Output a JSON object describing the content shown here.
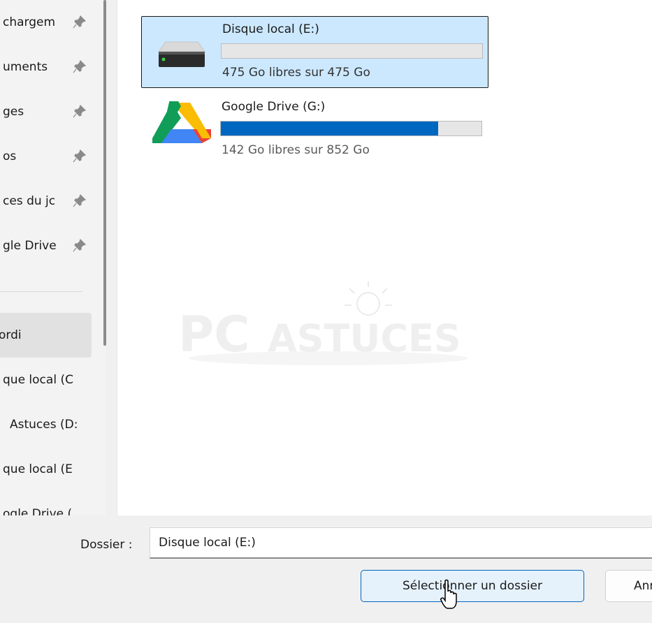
{
  "nav": {
    "items": [
      {
        "label": "chargem",
        "pinned": true
      },
      {
        "label": "uments",
        "pinned": true
      },
      {
        "label": "ges",
        "pinned": true
      },
      {
        "label": "os",
        "pinned": true
      },
      {
        "label": "ces du jc",
        "pinned": true
      },
      {
        "label": "gle Drive",
        "pinned": true
      },
      {
        "label": "ordi",
        "pinned": false
      },
      {
        "label": "que local (C",
        "pinned": false
      },
      {
        "label": "Astuces (D:",
        "pinned": false
      },
      {
        "label": "que local (E",
        "pinned": false
      },
      {
        "label": "ogle Drive (",
        "pinned": false
      }
    ]
  },
  "drives": [
    {
      "name": "Disque local (E:)",
      "free_text": "475 Go libres sur 475 Go",
      "used_fraction": 0.0,
      "selected": true,
      "icon": "hard-drive-icon"
    },
    {
      "name": "Google Drive (G:)",
      "free_text": "142 Go libres sur 852 Go",
      "used_fraction": 0.833,
      "selected": false,
      "icon": "google-drive-icon"
    }
  ],
  "watermark": {
    "part1": "PC",
    "part2": "ASTUCES"
  },
  "footer": {
    "folder_label": "Dossier :",
    "folder_value": "Disque local (E:)",
    "select_label": "Sélectionner un dossier",
    "cancel_label": "Annuler"
  },
  "colors": {
    "accent": "#0067c0",
    "selection": "#cce8ff",
    "bar_track": "#e6e6e6"
  }
}
